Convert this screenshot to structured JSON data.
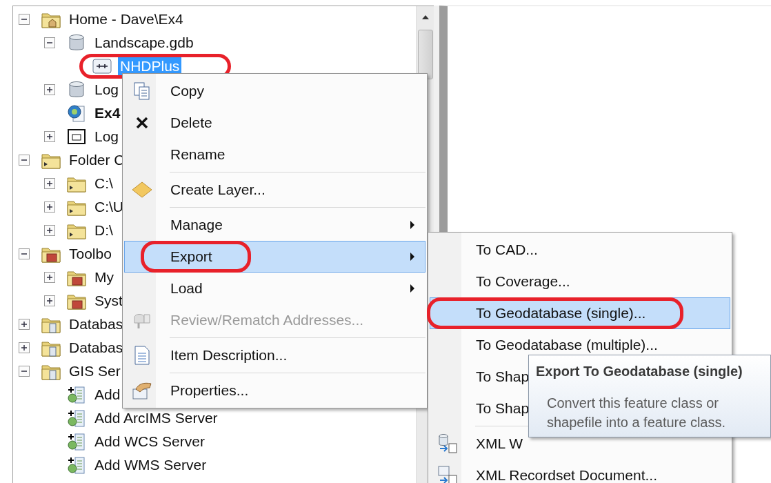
{
  "tree": [
    {
      "kind": "home-folder",
      "label": "Home - Dave\\Ex4",
      "expanded": true,
      "selected": false,
      "circled": false,
      "children": [
        {
          "kind": "geodatabase",
          "label": "Landscape.gdb",
          "expanded": true,
          "selected": false,
          "circled": false,
          "children": [
            {
              "kind": "feature-class",
              "label": "NHDPlus",
              "selected": true,
              "circled": true
            }
          ]
        },
        {
          "kind": "geodatabase",
          "label": "Log",
          "expanded": false,
          "selected": false,
          "circled": false
        },
        {
          "kind": "map-document",
          "label": "Ex4",
          "selected": false,
          "circled": false
        },
        {
          "kind": "layer-file",
          "label": "Log",
          "expanded": false,
          "selected": false,
          "circled": false
        }
      ]
    },
    {
      "kind": "folder-connections",
      "label": "Folder C",
      "expanded": true,
      "selected": false,
      "circled": false,
      "children": [
        {
          "kind": "folder",
          "label": "C:\\",
          "expanded": false,
          "selected": false,
          "circled": false
        },
        {
          "kind": "folder",
          "label": "C:\\U",
          "expanded": false,
          "selected": false,
          "circled": false
        },
        {
          "kind": "folder",
          "label": "D:\\",
          "expanded": false,
          "selected": false,
          "circled": false
        }
      ]
    },
    {
      "kind": "toolbox-folder",
      "label": "Toolbo",
      "expanded": true,
      "selected": false,
      "circled": false,
      "children": [
        {
          "kind": "toolbox-folder",
          "label": "My",
          "expanded": false,
          "selected": false,
          "circled": false
        },
        {
          "kind": "toolbox-folder",
          "label": "Syst",
          "expanded": false,
          "selected": false,
          "circled": false
        }
      ]
    },
    {
      "kind": "database-server",
      "label": "Databas",
      "expanded": false,
      "selected": false,
      "circled": false
    },
    {
      "kind": "database-connections",
      "label": "Databas",
      "expanded": false,
      "selected": false,
      "circled": false
    },
    {
      "kind": "gis-server",
      "label": "GIS Ser",
      "expanded": true,
      "selected": false,
      "circled": false,
      "children": [
        {
          "kind": "add-server",
          "label": "Add",
          "selected": false,
          "circled": false
        },
        {
          "kind": "add-server",
          "label": "Add ArcIMS Server",
          "selected": false,
          "circled": false
        },
        {
          "kind": "add-server",
          "label": "Add WCS Server",
          "selected": false,
          "circled": false
        },
        {
          "kind": "add-server",
          "label": "Add WMS Server",
          "selected": false,
          "circled": false
        }
      ]
    }
  ],
  "context_menu": [
    {
      "kind": "item",
      "label": "Copy",
      "submenu": false,
      "disabled": false,
      "selected": false,
      "circled": false
    },
    {
      "kind": "item",
      "label": "Delete",
      "submenu": false,
      "disabled": false,
      "selected": false,
      "circled": false
    },
    {
      "kind": "item",
      "label": "Rename",
      "submenu": false,
      "disabled": false,
      "selected": false,
      "circled": false
    },
    {
      "kind": "separator"
    },
    {
      "kind": "item",
      "label": "Create Layer...",
      "submenu": false,
      "disabled": false,
      "selected": false,
      "circled": false
    },
    {
      "kind": "separator"
    },
    {
      "kind": "item",
      "label": "Manage",
      "submenu": true,
      "disabled": false,
      "selected": false,
      "circled": false
    },
    {
      "kind": "item",
      "label": "Export",
      "submenu": true,
      "disabled": false,
      "selected": true,
      "circled": true
    },
    {
      "kind": "item",
      "label": "Load",
      "submenu": true,
      "disabled": false,
      "selected": false,
      "circled": false
    },
    {
      "kind": "item",
      "label": "Review/Rematch Addresses...",
      "submenu": false,
      "disabled": true,
      "selected": false,
      "circled": false
    },
    {
      "kind": "separator"
    },
    {
      "kind": "item",
      "label": "Item Description...",
      "submenu": false,
      "disabled": false,
      "selected": false,
      "circled": false
    },
    {
      "kind": "separator"
    },
    {
      "kind": "item",
      "label": "Properties...",
      "submenu": false,
      "disabled": false,
      "selected": false,
      "circled": false
    }
  ],
  "export_submenu": [
    {
      "kind": "item",
      "label": "To CAD...",
      "selected": false,
      "circled": false
    },
    {
      "kind": "item",
      "label": "To Coverage...",
      "selected": false,
      "circled": false
    },
    {
      "kind": "item",
      "label": "To Geodatabase (single)...",
      "selected": true,
      "circled": true
    },
    {
      "kind": "item",
      "label": "To Geodatabase (multiple)...",
      "selected": false,
      "circled": false
    },
    {
      "kind": "item",
      "label": "To Shap",
      "selected": false,
      "circled": false
    },
    {
      "kind": "item",
      "label": "To Shap",
      "selected": false,
      "circled": false
    },
    {
      "kind": "separator"
    },
    {
      "kind": "item",
      "label": "XML W",
      "selected": false,
      "circled": false
    },
    {
      "kind": "item",
      "label": "XML Recordset Document...",
      "selected": false,
      "circled": false
    }
  ],
  "tooltip": {
    "title": "Export To Geodatabase (single)",
    "text": "Convert this feature class or shapefile into a feature class."
  }
}
